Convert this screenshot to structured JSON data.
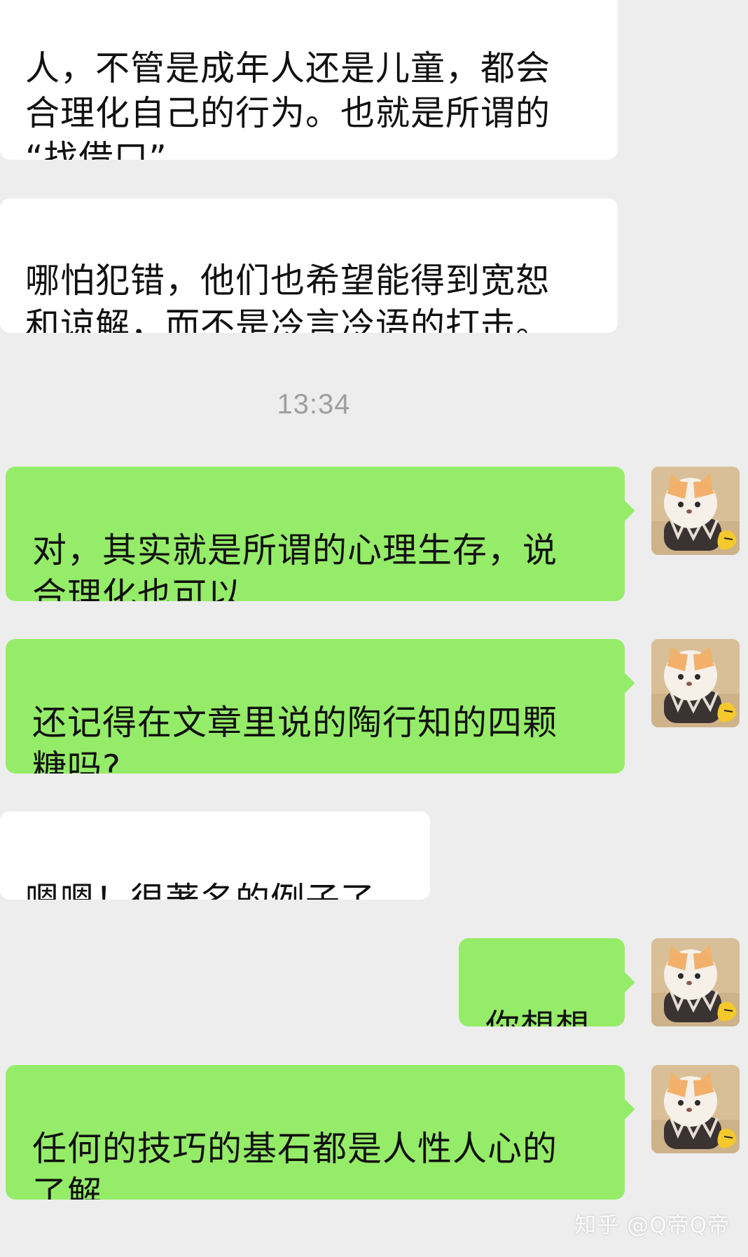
{
  "messages": [
    {
      "side": "incoming",
      "text": "人，不管是成年人还是儿童，都会\n合理化自己的行为。也就是所谓的\n“找借口”。"
    },
    {
      "side": "incoming",
      "text": "哪怕犯错，他们也希望能得到宽恕\n和谅解，而不是冷言冷语的打击。"
    },
    {
      "side": "outgoing",
      "text": "对，其实就是所谓的心理生存，说\n合理化也可以"
    },
    {
      "side": "outgoing",
      "text": "还记得在文章里说的陶行知的四颗\n糖吗?"
    },
    {
      "side": "incoming",
      "text": "嗯嗯！很著名的例子了"
    },
    {
      "side": "outgoing",
      "text": "你想想"
    },
    {
      "side": "outgoing",
      "text": "任何的技巧的基石都是人性人心的\n了解"
    }
  ],
  "timestamp": "13:34",
  "watermark": "知乎 @Q帝Q帝",
  "avatar": {
    "icon": "cat-avatar-icon"
  },
  "colors": {
    "background": "#ededed",
    "incoming_bubble": "#ffffff",
    "outgoing_bubble": "#95ec69",
    "timestamp_text": "#9e9e9e"
  }
}
